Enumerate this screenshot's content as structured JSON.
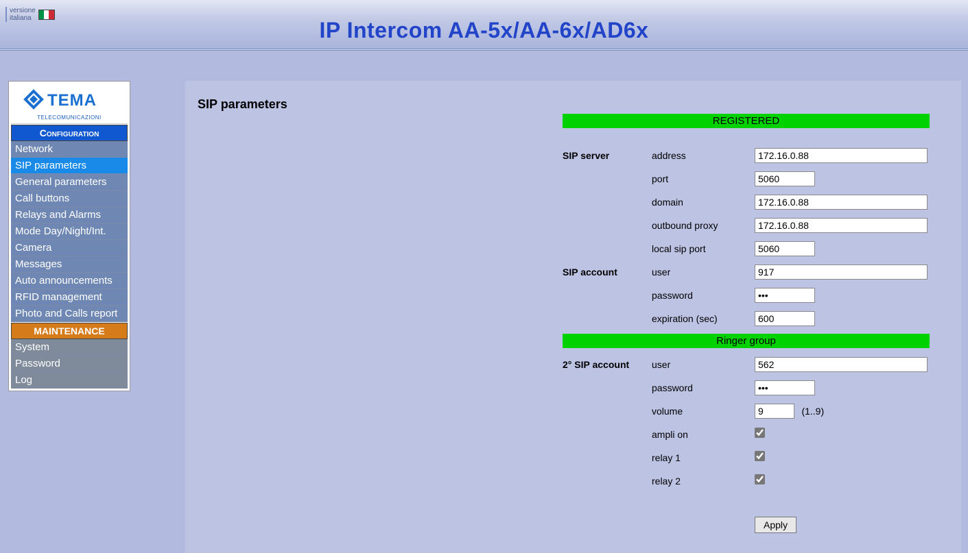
{
  "header": {
    "lang_line1": "versione",
    "lang_line2": "italiana",
    "title": "IP Intercom AA-5x/AA-6x/AD6x"
  },
  "sidebar": {
    "logo_text": "TEMA",
    "logo_sub": "TELECOMUNICAZIONI",
    "section_config": "Configuration",
    "section_maint": "MAINTENANCE",
    "config_items": [
      "Network",
      "SIP parameters",
      "General parameters",
      "Call buttons",
      "Relays and Alarms",
      "Mode Day/Night/Int.",
      "Camera",
      "Messages",
      "Auto announcements",
      "RFID management",
      "Photo and Calls report"
    ],
    "maint_items": [
      "System",
      "Password",
      "Log"
    ],
    "active_index": 1
  },
  "main": {
    "title": "SIP parameters",
    "status": "REGISTERED",
    "group_title": "Ringer group",
    "sections": {
      "sip_server": "SIP server",
      "sip_account": "SIP account",
      "second_account": "2° SIP account"
    },
    "labels": {
      "address": "address",
      "port": "port",
      "domain": "domain",
      "outbound_proxy": "outbound proxy",
      "local_sip_port": "local sip port",
      "user": "user",
      "password": "password",
      "expiration": "expiration (sec)",
      "volume": "volume",
      "volume_hint": "(1..9)",
      "ampli_on": "ampli on",
      "relay1": "relay 1",
      "relay2": "relay 2"
    },
    "values": {
      "address": "172.16.0.88",
      "port": "5060",
      "domain": "172.16.0.88",
      "outbound_proxy": "172.16.0.88",
      "local_sip_port": "5060",
      "user1": "917",
      "password1": "•••",
      "expiration": "600",
      "user2": "562",
      "password2": "•••",
      "volume": "9",
      "ampli_on": true,
      "relay1": true,
      "relay2": true
    },
    "apply": "Apply"
  }
}
